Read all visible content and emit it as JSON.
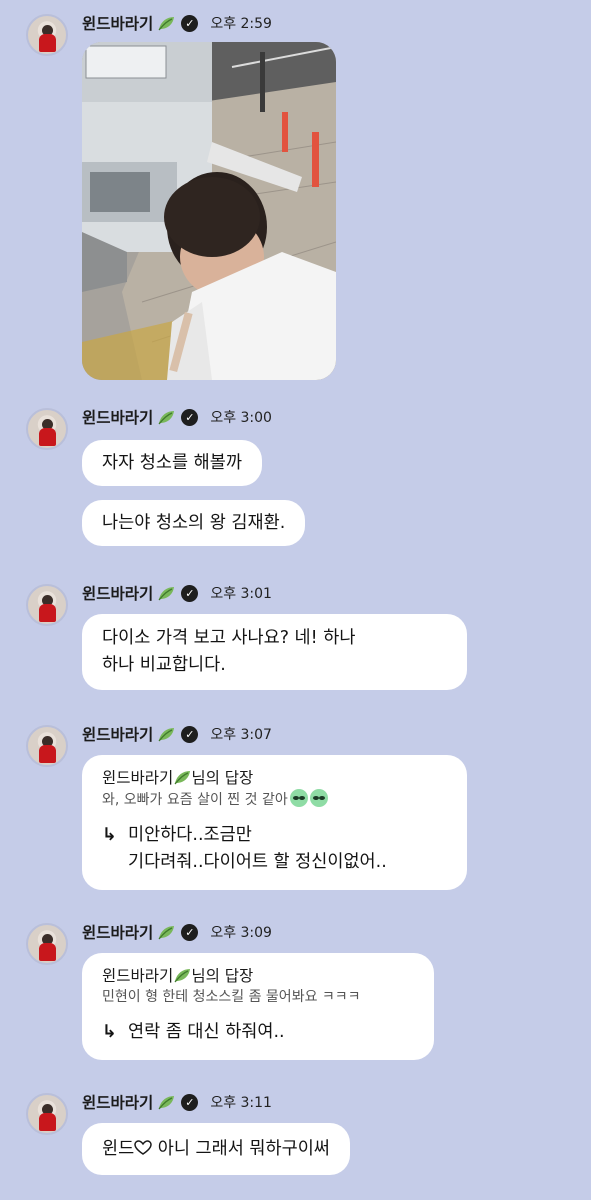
{
  "sender": {
    "name": "윈드바라기",
    "badge_icon": "verified-icon",
    "leaf_icon": "leaf-icon"
  },
  "messages": [
    {
      "time": "오후 2:59",
      "type": "photo"
    },
    {
      "time": "오후 3:00",
      "bubbles": [
        "자자 청소를 해볼까",
        "나는야 청소의 왕 김재환."
      ]
    },
    {
      "time": "오후 3:01",
      "bubbles": [
        "다이소 가격 보고 사나요? 네! 하나",
        "하나 비교합니다."
      ]
    },
    {
      "time": "오후 3:07",
      "reply": {
        "head_name": "윈드바라기",
        "head_suffix": "님의 답장",
        "quote": "와, 오빠가 요즘 살이 찐 것 같아",
        "arrow": "↳",
        "line1": "미안하다..조금만",
        "line2": "기다려줘..다이어트 할 정신이없어.."
      }
    },
    {
      "time": "오후 3:09",
      "reply": {
        "head_name": "윈드바라기",
        "head_suffix": "님의 답장",
        "quote": "민현이 형 한테 청소스킬 좀 물어봐요 ㅋㅋㅋ",
        "arrow": "↳",
        "line1": "연락 좀 대신 하줘여.."
      }
    },
    {
      "time": "오후 3:11",
      "bubble_prefix": "윈드",
      "bubble_suffix": " 아니 그래서 뭐하구이써"
    }
  ],
  "colors": {
    "background": "#c5cce8",
    "bubble": "#ffffff",
    "leaf": "#6aa84f"
  }
}
